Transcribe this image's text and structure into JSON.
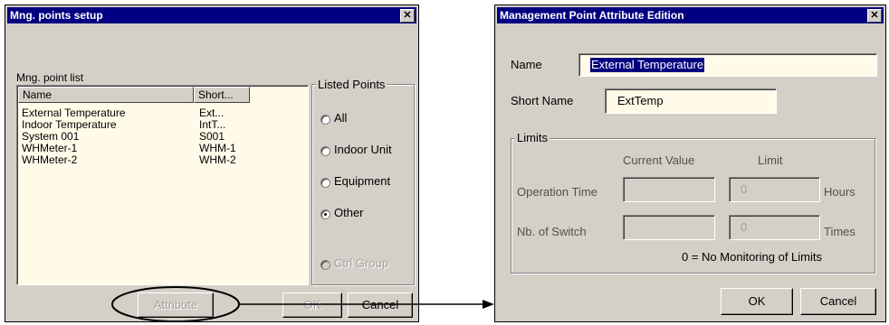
{
  "setup_window": {
    "title": "Mng. points setup",
    "list_label": "Mng. point list",
    "columns": [
      "Name",
      "Short..."
    ],
    "rows": [
      {
        "name": "External Temperature",
        "short": "Ext..."
      },
      {
        "name": "Indoor Temperature",
        "short": "IntT..."
      },
      {
        "name": "System 001",
        "short": "S001"
      },
      {
        "name": "WHMeter-1",
        "short": "WHM-1"
      },
      {
        "name": "WHMeter-2",
        "short": "WHM-2"
      }
    ],
    "listed_points": {
      "label": "Listed Points",
      "options": [
        "All",
        "Indoor Unit",
        "Equipment",
        "Other",
        "Ctrl Group"
      ],
      "selected": "Other"
    },
    "buttons": {
      "attribute": "Attribute",
      "ok": "OK",
      "cancel": "Cancel"
    }
  },
  "edit_window": {
    "title": "Management Point Attribute Edition",
    "name_label": "Name",
    "name_value": "External Temperature",
    "short_name_label": "Short Name",
    "short_name_value": "ExtTemp",
    "limits": {
      "label": "Limits",
      "current_value_header": "Current Value",
      "limit_header": "Limit",
      "operation_time_label": "Operation Time",
      "operation_time_limit": "0",
      "hours_unit": "Hours",
      "switch_label": "Nb. of Switch",
      "switch_limit": "0",
      "times_unit": "Times",
      "note": "0 = No Monitoring of Limits"
    },
    "buttons": {
      "ok": "OK",
      "cancel": "Cancel"
    }
  },
  "colors": {
    "titlebar": "#000080",
    "window_bg": "#d4d0c8",
    "field_bg": "#fffbe8",
    "selection": "#000080"
  }
}
